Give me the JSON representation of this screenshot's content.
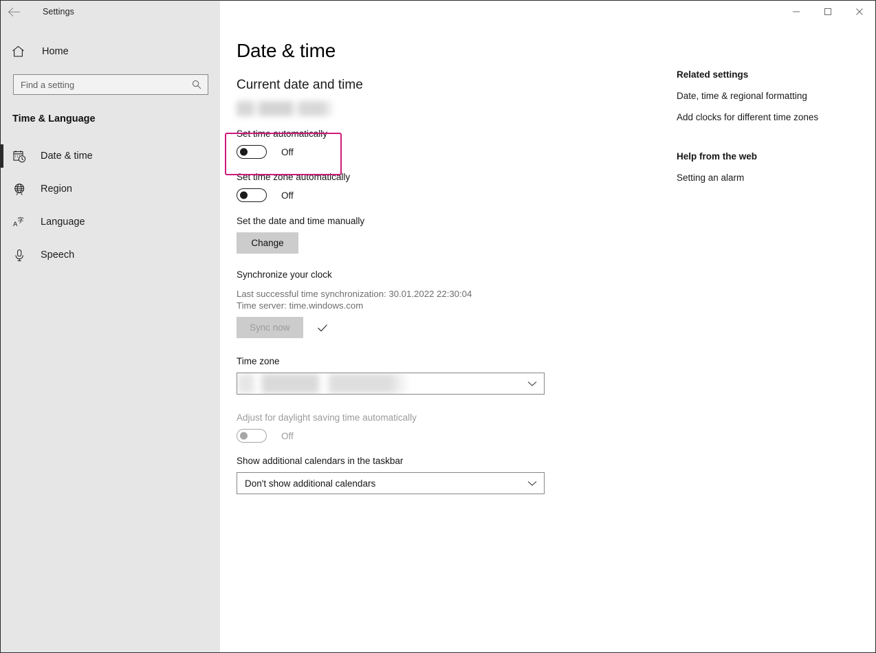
{
  "window": {
    "app_title": "Settings",
    "back_icon": "back-arrow-icon",
    "minimize_label": "–",
    "maximize_label": "□",
    "close_label": "✕",
    "accent_highlight_color": "#cc1a7a",
    "sidebar_bg": "#e6e6e6",
    "content_bg": "#ffffff"
  },
  "sidebar": {
    "home_label": "Home",
    "home_icon": "home-icon",
    "search": {
      "placeholder": "Find a setting",
      "value": "",
      "icon": "search-icon"
    },
    "section_header": "Time & Language",
    "items": [
      {
        "label": "Date & time",
        "icon": "calendar-clock-icon",
        "active": true
      },
      {
        "label": "Region",
        "icon": "globe-icon",
        "active": false
      },
      {
        "label": "Language",
        "icon": "language-icon",
        "active": false
      },
      {
        "label": "Speech",
        "icon": "microphone-icon",
        "active": false
      }
    ]
  },
  "main": {
    "page_title": "Date & time",
    "current_section_title": "Current date and time",
    "current_datetime_value": "",
    "set_time_automatically": {
      "label": "Set time automatically",
      "state": "Off",
      "highlighted": true
    },
    "set_timezone_automatically": {
      "label": "Set time zone automatically",
      "state": "Off"
    },
    "manual": {
      "label": "Set the date and time manually",
      "button_label": "Change"
    },
    "synchronize": {
      "title": "Synchronize your clock",
      "last_sync": "Last successful time synchronization: 30.01.2022 22:30:04",
      "time_server": "Time server: time.windows.com",
      "button_label": "Sync now",
      "button_disabled": true,
      "status_icon": "checkmark-icon"
    },
    "time_zone": {
      "label": "Time zone",
      "value": "",
      "chevron_icon": "chevron-down-icon"
    },
    "daylight_saving": {
      "label": "Adjust for daylight saving time automatically",
      "state": "Off",
      "disabled": true
    },
    "additional_calendars": {
      "label": "Show additional calendars in the taskbar",
      "value": "Don't show additional calendars",
      "chevron_icon": "chevron-down-icon"
    }
  },
  "right_rail": {
    "related_settings_header": "Related settings",
    "related_links": [
      "Date, time & regional formatting",
      "Add clocks for different time zones"
    ],
    "help_header": "Help from the web",
    "help_links": [
      "Setting an alarm"
    ]
  }
}
